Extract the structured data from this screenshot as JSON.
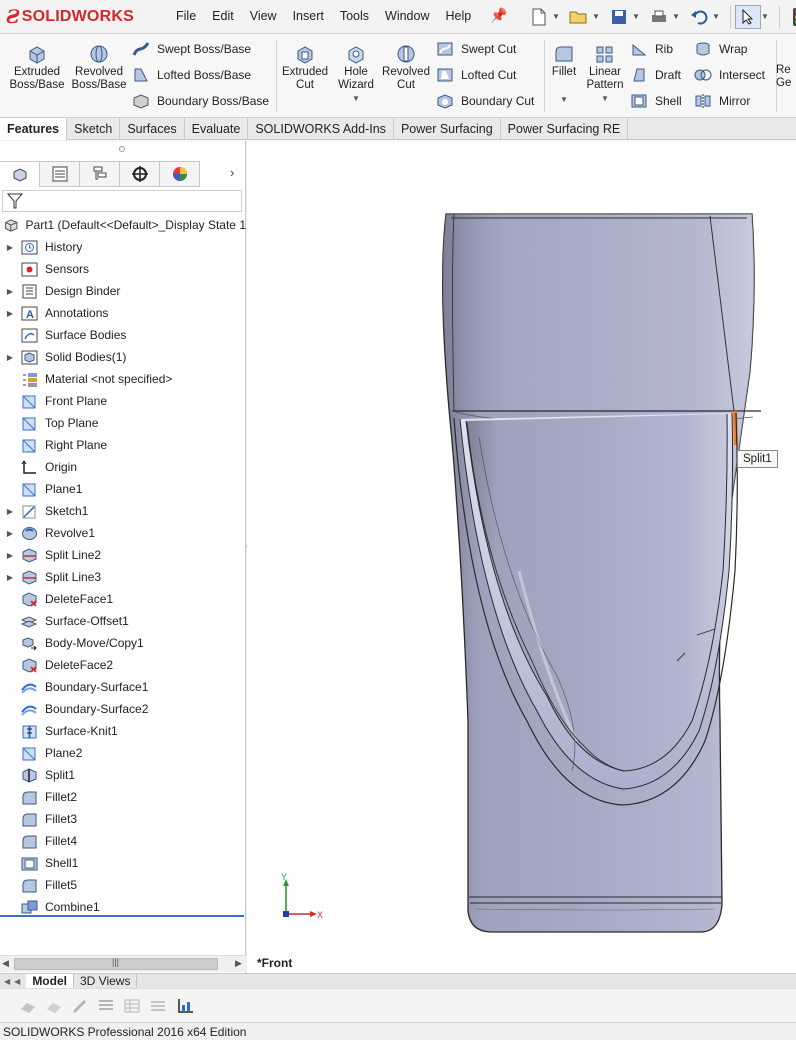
{
  "app": {
    "brand": "SOLIDWORKS",
    "status": "SOLIDWORKS Professional 2016 x64 Edition"
  },
  "menu": [
    "File",
    "Edit",
    "View",
    "Insert",
    "Tools",
    "Window",
    "Help"
  ],
  "ribbon": {
    "extruded_boss": "Extruded Boss/Base",
    "revolved_boss": "Revolved Boss/Base",
    "swept_boss": "Swept Boss/Base",
    "lofted_boss": "Lofted Boss/Base",
    "boundary_boss": "Boundary Boss/Base",
    "extruded_cut": "Extruded Cut",
    "hole_wizard": "Hole Wizard",
    "revolved_cut": "Revolved Cut",
    "swept_cut": "Swept Cut",
    "lofted_cut": "Lofted Cut",
    "boundary_cut": "Boundary Cut",
    "fillet": "Fillet",
    "linear_pattern": "Linear Pattern",
    "rib": "Rib",
    "draft": "Draft",
    "shell": "Shell",
    "wrap": "Wrap",
    "intersect": "Intersect",
    "mirror": "Mirror",
    "ref_geom": "Re Ge"
  },
  "tabs": [
    "Features",
    "Sketch",
    "Surfaces",
    "Evaluate",
    "SOLIDWORKS Add-Ins",
    "Power Surfacing",
    "Power Surfacing RE"
  ],
  "tree": {
    "root": "Part1  (Default<<Default>_Display State 1",
    "items": [
      {
        "label": "History",
        "expand": true,
        "icon": "history-icon"
      },
      {
        "label": "Sensors",
        "expand": false,
        "icon": "sensors-icon"
      },
      {
        "label": "Design Binder",
        "expand": true,
        "icon": "design-binder-icon"
      },
      {
        "label": "Annotations",
        "expand": true,
        "icon": "annotations-icon"
      },
      {
        "label": "Surface Bodies",
        "expand": false,
        "icon": "surface-bodies-icon"
      },
      {
        "label": "Solid Bodies(1)",
        "expand": true,
        "icon": "solid-bodies-icon"
      },
      {
        "label": "Material <not specified>",
        "expand": false,
        "icon": "material-icon"
      },
      {
        "label": "Front Plane",
        "expand": false,
        "icon": "plane-icon"
      },
      {
        "label": "Top Plane",
        "expand": false,
        "icon": "plane-icon"
      },
      {
        "label": "Right Plane",
        "expand": false,
        "icon": "plane-icon"
      },
      {
        "label": "Origin",
        "expand": false,
        "icon": "origin-icon"
      },
      {
        "label": "Plane1",
        "expand": false,
        "icon": "plane-icon"
      },
      {
        "label": "Sketch1",
        "expand": true,
        "icon": "sketch-icon"
      },
      {
        "label": "Revolve1",
        "expand": true,
        "icon": "revolve-icon"
      },
      {
        "label": "Split Line2",
        "expand": true,
        "icon": "split-line-icon"
      },
      {
        "label": "Split Line3",
        "expand": true,
        "icon": "split-line-icon"
      },
      {
        "label": "DeleteFace1",
        "expand": false,
        "icon": "delete-face-icon"
      },
      {
        "label": "Surface-Offset1",
        "expand": false,
        "icon": "surface-offset-icon"
      },
      {
        "label": "Body-Move/Copy1",
        "expand": false,
        "icon": "body-move-icon"
      },
      {
        "label": "DeleteFace2",
        "expand": false,
        "icon": "delete-face-icon"
      },
      {
        "label": "Boundary-Surface1",
        "expand": false,
        "icon": "boundary-surface-icon"
      },
      {
        "label": "Boundary-Surface2",
        "expand": false,
        "icon": "boundary-surface-icon"
      },
      {
        "label": "Surface-Knit1",
        "expand": false,
        "icon": "surface-knit-icon"
      },
      {
        "label": "Plane2",
        "expand": false,
        "icon": "plane-icon"
      },
      {
        "label": "Split1",
        "expand": false,
        "icon": "split-icon"
      },
      {
        "label": "Fillet2",
        "expand": false,
        "icon": "fillet-icon"
      },
      {
        "label": "Fillet3",
        "expand": false,
        "icon": "fillet-icon"
      },
      {
        "label": "Fillet4",
        "expand": false,
        "icon": "fillet-icon"
      },
      {
        "label": "Shell1",
        "expand": false,
        "icon": "shell-icon"
      },
      {
        "label": "Fillet5",
        "expand": false,
        "icon": "fillet-icon"
      },
      {
        "label": "Combine1",
        "expand": false,
        "icon": "combine-icon"
      }
    ]
  },
  "graphics": {
    "view_name": "*Front",
    "tooltip": "Split1",
    "axis_x": "X",
    "axis_y": "Y"
  },
  "bottom_tabs": [
    "Model",
    "3D Views"
  ],
  "colors": {
    "accent": "#2c6bd6",
    "brand": "#d9252b",
    "highlight": "#f07d1a"
  }
}
